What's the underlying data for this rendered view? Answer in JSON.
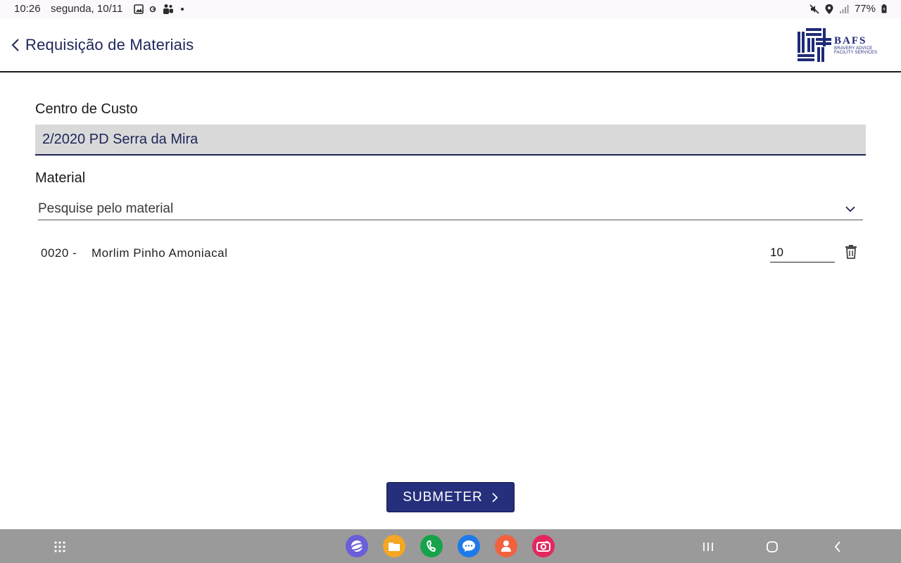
{
  "statusbar": {
    "time": "10:26",
    "date": "segunda, 10/11",
    "battery": "77%"
  },
  "header": {
    "title": "Requisição de Materiais",
    "logo": {
      "name": "BAFS",
      "line1": "BRAVERY ADVICE",
      "line2": "FACILITY SERVICES"
    }
  },
  "form": {
    "cost_center_label": "Centro de Custo",
    "cost_center_value": "2/2020 PD Serra da Mira",
    "material_label": "Material",
    "material_placeholder": "Pesquise pelo material"
  },
  "items": [
    {
      "code": "0020 -",
      "name": "Morlim Pinho Amoniacal",
      "quantity": "10"
    }
  ],
  "actions": {
    "submit_label": "SUBMETER"
  },
  "colors": {
    "accent": "#252f7c",
    "title": "#1e2559",
    "field_bg": "#d9d9d9",
    "navbar_bg": "#9a9a9a"
  },
  "dock_apps": [
    "browser-icon",
    "files-icon",
    "phone-icon",
    "messages-icon",
    "contacts-icon",
    "camera-icon"
  ]
}
